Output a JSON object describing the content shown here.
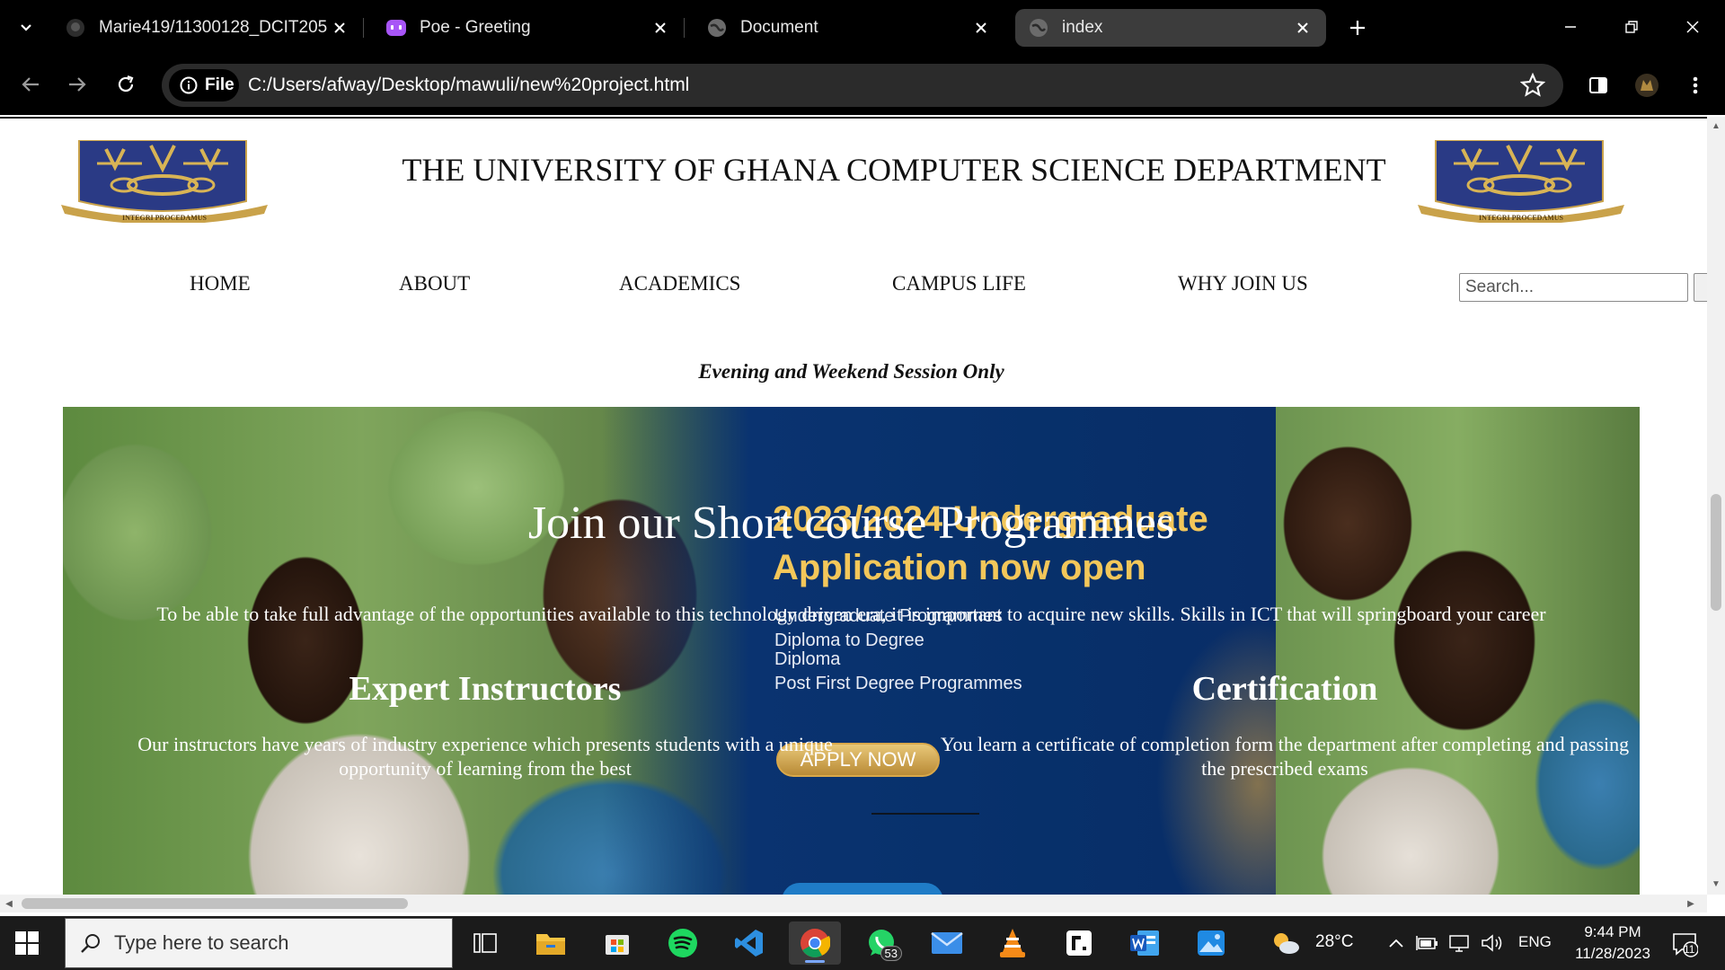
{
  "browser": {
    "tabs": [
      {
        "title": "Marie419/11300128_DCIT205",
        "icon": "github-icon",
        "active": false
      },
      {
        "title": "Poe - Greeting",
        "icon": "poe-icon",
        "active": false
      },
      {
        "title": "Document",
        "icon": "globe-icon",
        "active": false
      },
      {
        "title": "index",
        "icon": "globe-icon",
        "active": true
      }
    ],
    "site_info_label": "File",
    "url": "C:/Users/afway/Desktop/mawuli/new%20project.html"
  },
  "page": {
    "heading": "THE UNIVERSITY OF GHANA COMPUTER SCIENCE DEPARTMENT",
    "crest_motto": "INTEGRI PROCEDAMUS",
    "nav": [
      {
        "label": "HOME"
      },
      {
        "label": "ABOUT"
      },
      {
        "label": "ACADEMICS"
      },
      {
        "label": "CAMPUS LIFE"
      },
      {
        "label": "WHY JOIN US"
      }
    ],
    "search_placeholder": "Search...",
    "tagline": "Evening and Weekend Session Only",
    "hero": {
      "banner_title_line1": "2023/2024 Undergraduate",
      "banner_title_line2": "Application now open",
      "banner_items": [
        "Undergraduate Programmes",
        "Diploma to Degree",
        "Diploma",
        "Post First Degree Programmes"
      ],
      "apply_label": "APPLY NOW",
      "title": "Join our Short course Programmes",
      "intro": "To be able to take full advantage of the opportunities available to this technology driven era, it is important to acquire new skills. Skills in ICT that will springboard your career",
      "features": [
        {
          "title": "Expert Instructors",
          "text": "Our instructors have years of industry experience which presents students with a unique opportunity of learning from the best"
        },
        {
          "title": "Certification",
          "text": "You learn a certificate of completion form the department after completing and passing the prescribed exams"
        }
      ]
    }
  },
  "taskbar": {
    "search_placeholder": "Type here to search",
    "whatsapp_badge": "53",
    "weather": "28°C",
    "language": "ENG",
    "time": "9:44 PM",
    "date": "11/28/2023",
    "notification_count": "11"
  },
  "colors": {
    "chrome_bg": "#000000",
    "omnibox_bg": "#2b2b2b",
    "banner_blue": "#07306a",
    "banner_gold": "#f3c75a",
    "taskbar_bg": "#1b1b1b"
  }
}
